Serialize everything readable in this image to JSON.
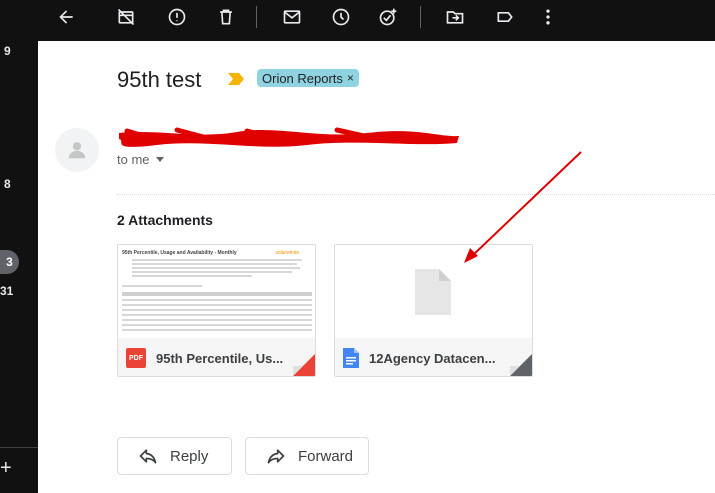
{
  "left_rail": {
    "counts": [
      "9",
      "8",
      "3",
      "31"
    ],
    "add_label": "+"
  },
  "toolbar": {
    "icons": [
      "back-arrow",
      "archive-off",
      "report-spam",
      "delete",
      "mark-unread",
      "snooze",
      "add-task",
      "move-to",
      "label",
      "more"
    ]
  },
  "email": {
    "subject": "95th test",
    "label": "Orion Reports",
    "label_close": "×",
    "sender": "",
    "to": "to me",
    "attachments_heading": "2 Attachments",
    "attachments": [
      {
        "name": "95th Percentile, Us...",
        "type": "PDF",
        "preview_title": "95th Percentile, Usage and Availability - Monthly",
        "preview_brand": "solarwinds",
        "color": "#ea4335"
      },
      {
        "name": "12Agency Datacen...",
        "type": "doc",
        "color": "#4285f4"
      }
    ],
    "reply_label": "Reply",
    "forward_label": "Forward"
  },
  "colors": {
    "label_chip": "#8fd3e0",
    "importance": "#f4b400",
    "annotation": "#e00000"
  }
}
